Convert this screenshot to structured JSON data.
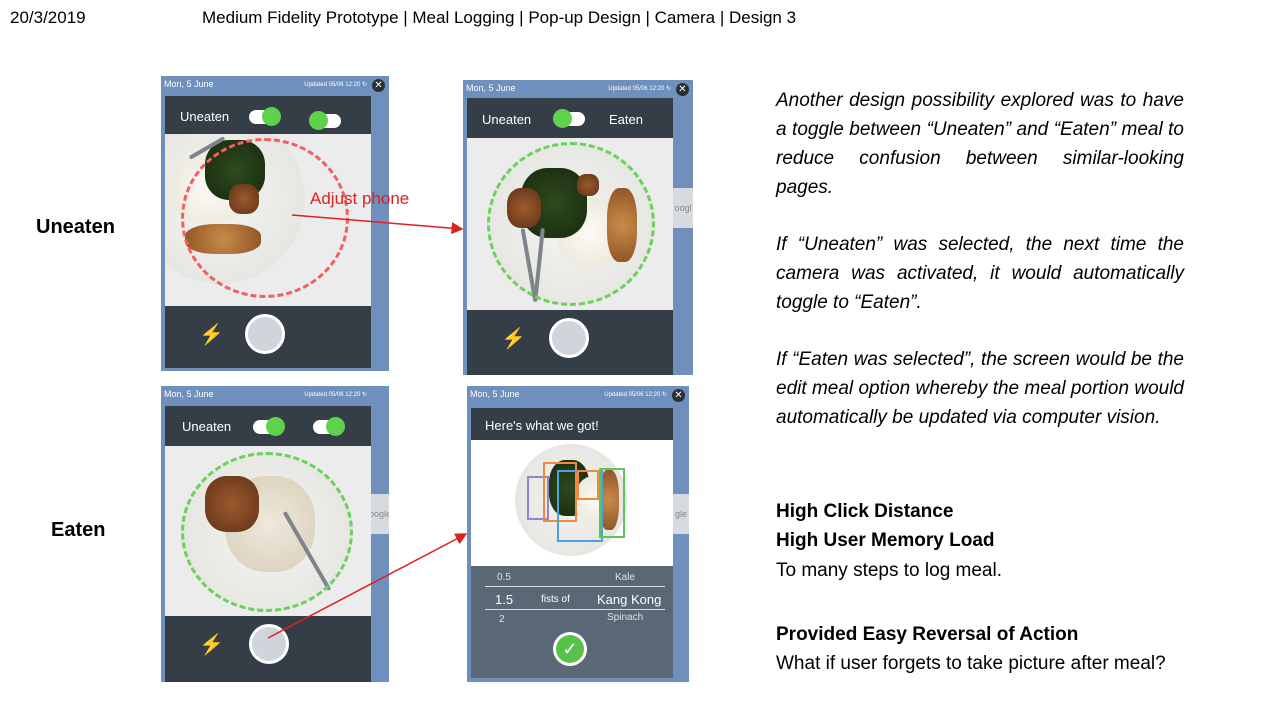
{
  "header": {
    "date": "20/3/2019",
    "title": "Medium Fidelity Prototype | Meal Logging | Pop-up Design | Camera | Design 3"
  },
  "row_labels": {
    "uneaten": "Uneaten",
    "eaten": "Eaten"
  },
  "annotation": {
    "adjust_phone": "Adjust phone"
  },
  "phone_common": {
    "status_date": "Mon, 5 June",
    "status_updated": "Updated 05/06 12:20 ↻",
    "close_icon": "close-icon",
    "flash_icon": "flash-off-icon"
  },
  "screen1": {
    "toggle_label": "Uneaten"
  },
  "screen2": {
    "toggle_label_left": "Uneaten",
    "toggle_label_right": "Eaten"
  },
  "screen3": {
    "toggle_label": "Uneaten"
  },
  "screen4": {
    "heading": "Here's what we got!",
    "list": {
      "row1_qty": "0.5",
      "row1_item": "Kale",
      "row2_qty": "1.5",
      "row2_unit": "fists of",
      "row2_item": "Kang Kong",
      "row3_qty": "2",
      "row3_item": "Spinach"
    },
    "confirm_icon": "check-icon"
  },
  "description": {
    "p1": "Another design possibility explored was to have a toggle between “Uneaten” and “Eaten” meal to reduce confusion between similar-looking pages.",
    "p2": "If “Uneaten” was selected, the next time the camera was activated, it would automatically toggle to “Eaten”.",
    "p3": "If “Eaten was selected”, the screen would be the edit meal option whereby the meal portion would automatically be updated via computer vision."
  },
  "findings": {
    "f1": "High Click Distance",
    "f2": "High User Memory Load",
    "f3": "To many steps to log meal.",
    "f4": "Provided Easy Reversal of Action",
    "f5": "What if user forgets to take picture after meal?"
  },
  "colors": {
    "app_bar": "#353d47",
    "toggle_on": "#5fd24c",
    "guide_red": "#f06060",
    "guide_green": "#6ad15a",
    "arrow": "#e02020"
  }
}
